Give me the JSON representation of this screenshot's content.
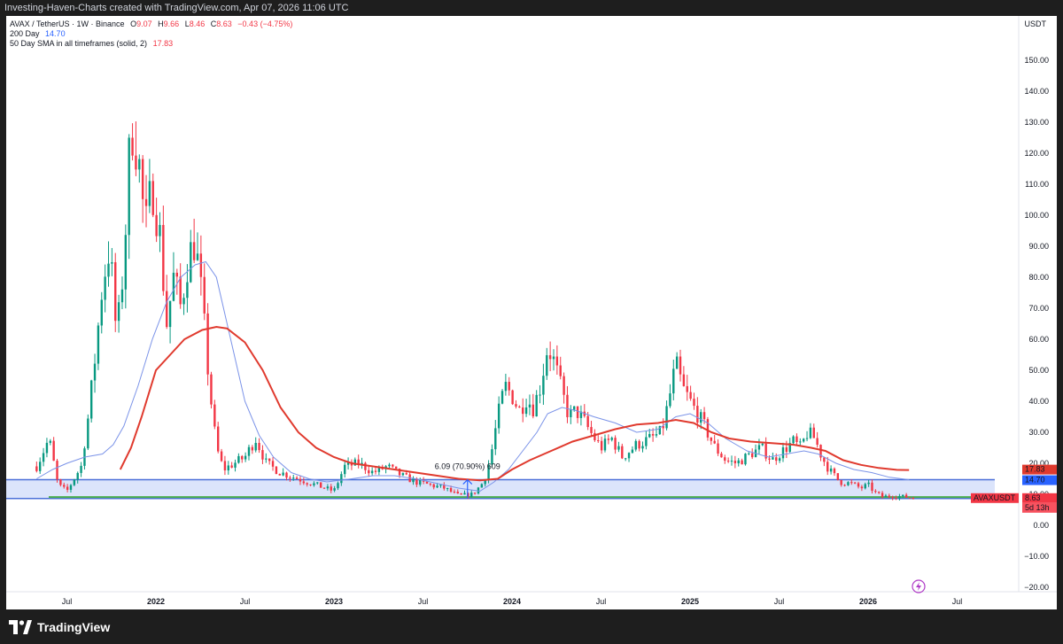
{
  "header": {
    "text": "Investing-Haven-Charts created with TradingView.com, Apr 07, 2026 11:06 UTC"
  },
  "legend": {
    "symbol_line": "AVAX / TetherUS · 1W · Binance",
    "ohlc": [
      {
        "k": "O",
        "v": "9.07"
      },
      {
        "k": "H",
        "v": "9.66"
      },
      {
        "k": "L",
        "v": "8.46"
      },
      {
        "k": "C",
        "v": "8.63"
      }
    ],
    "change": "−0.43 (−4.75%)",
    "sma200_label": "200 Day",
    "sma200_value": "14.70",
    "sma50_label": "50 Day SMA in all timeframes (solid, 2)",
    "sma50_value": "17.83"
  },
  "currency": "USDT",
  "footer": {
    "brand": "TradingView"
  },
  "colors": {
    "up": "#089981",
    "down": "#f23645",
    "sma50": "#e03a2e",
    "sma200": "#7b93e8",
    "zone_fill": "#dbe4fb",
    "zone_line": "#4a6fd8",
    "support_line": "#4caf50"
  },
  "chart_data": {
    "type": "candlestick",
    "symbol": "AVAXUSDT",
    "ylim": [
      -20,
      160
    ],
    "y_ticks": [
      "−20.00",
      "−10.00",
      "0.00",
      "10.00",
      "20.00",
      "30.00",
      "40.00",
      "50.00",
      "60.00",
      "70.00",
      "80.00",
      "90.00",
      "100.00",
      "110.00",
      "120.00",
      "130.00",
      "140.00",
      "150.00"
    ],
    "x_range": [
      2021.32,
      2026.98
    ],
    "x_ticks": [
      {
        "label": "Jul",
        "x": 2021.5
      },
      {
        "label": "2022",
        "x": 2022.0
      },
      {
        "label": "Jul",
        "x": 2022.5
      },
      {
        "label": "2023",
        "x": 2023.0
      },
      {
        "label": "Jul",
        "x": 2023.5
      },
      {
        "label": "2024",
        "x": 2024.0
      },
      {
        "label": "Jul",
        "x": 2024.5
      },
      {
        "label": "2025",
        "x": 2025.0
      },
      {
        "label": "Jul",
        "x": 2025.5
      },
      {
        "label": "2026",
        "x": 2026.0
      },
      {
        "label": "Jul",
        "x": 2026.5
      }
    ],
    "price_anchors": [
      [
        2021.33,
        19
      ],
      [
        2021.4,
        28
      ],
      [
        2021.45,
        13
      ],
      [
        2021.5,
        11
      ],
      [
        2021.58,
        19
      ],
      [
        2021.62,
        35
      ],
      [
        2021.66,
        55
      ],
      [
        2021.7,
        78
      ],
      [
        2021.74,
        90
      ],
      [
        2021.78,
        60
      ],
      [
        2021.82,
        85
      ],
      [
        2021.86,
        130
      ],
      [
        2021.9,
        120
      ],
      [
        2021.94,
        95
      ],
      [
        2021.98,
        110
      ],
      [
        2022.02,
        95
      ],
      [
        2022.06,
        65
      ],
      [
        2022.1,
        80
      ],
      [
        2022.14,
        70
      ],
      [
        2022.18,
        86
      ],
      [
        2022.22,
        92
      ],
      [
        2022.26,
        72
      ],
      [
        2022.3,
        45
      ],
      [
        2022.34,
        25
      ],
      [
        2022.38,
        18
      ],
      [
        2022.44,
        20
      ],
      [
        2022.5,
        22
      ],
      [
        2022.56,
        28
      ],
      [
        2022.62,
        20
      ],
      [
        2022.7,
        17
      ],
      [
        2022.8,
        15
      ],
      [
        2022.9,
        13
      ],
      [
        2023.0,
        11
      ],
      [
        2023.06,
        19
      ],
      [
        2023.14,
        20
      ],
      [
        2023.22,
        17
      ],
      [
        2023.3,
        19
      ],
      [
        2023.38,
        16
      ],
      [
        2023.46,
        14
      ],
      [
        2023.54,
        13
      ],
      [
        2023.62,
        12
      ],
      [
        2023.7,
        9.5
      ],
      [
        2023.78,
        10
      ],
      [
        2023.84,
        14
      ],
      [
        2023.88,
        22
      ],
      [
        2023.92,
        35
      ],
      [
        2023.96,
        45
      ],
      [
        2024.0,
        42
      ],
      [
        2024.04,
        37
      ],
      [
        2024.08,
        41
      ],
      [
        2024.12,
        38
      ],
      [
        2024.16,
        45
      ],
      [
        2024.2,
        58
      ],
      [
        2024.24,
        52
      ],
      [
        2024.28,
        43
      ],
      [
        2024.32,
        35
      ],
      [
        2024.36,
        37
      ],
      [
        2024.4,
        34
      ],
      [
        2024.44,
        30
      ],
      [
        2024.5,
        25
      ],
      [
        2024.56,
        28
      ],
      [
        2024.62,
        22
      ],
      [
        2024.7,
        26
      ],
      [
        2024.78,
        28
      ],
      [
        2024.84,
        30
      ],
      [
        2024.88,
        40
      ],
      [
        2024.92,
        52
      ],
      [
        2024.96,
        44
      ],
      [
        2025.0,
        40
      ],
      [
        2025.04,
        36
      ],
      [
        2025.08,
        32
      ],
      [
        2025.14,
        25
      ],
      [
        2025.2,
        21
      ],
      [
        2025.26,
        20
      ],
      [
        2025.34,
        23
      ],
      [
        2025.4,
        25
      ],
      [
        2025.46,
        21
      ],
      [
        2025.52,
        24
      ],
      [
        2025.58,
        27
      ],
      [
        2025.62,
        25
      ],
      [
        2025.66,
        30
      ],
      [
        2025.7,
        28
      ],
      [
        2025.74,
        22
      ],
      [
        2025.78,
        18
      ],
      [
        2025.84,
        14
      ],
      [
        2025.9,
        13.5
      ],
      [
        2025.96,
        12
      ],
      [
        2026.0,
        13
      ],
      [
        2026.04,
        10.5
      ],
      [
        2026.08,
        9.2
      ],
      [
        2026.14,
        9.5
      ],
      [
        2026.22,
        9.1
      ],
      [
        2026.27,
        8.63
      ]
    ],
    "series": [
      {
        "name": "50 Day SMA in all timeframes (solid, 2)",
        "points": [
          [
            2021.8,
            18
          ],
          [
            2021.86,
            25
          ],
          [
            2021.92,
            35
          ],
          [
            2022.0,
            50
          ],
          [
            2022.08,
            55
          ],
          [
            2022.16,
            60
          ],
          [
            2022.26,
            63
          ],
          [
            2022.34,
            64
          ],
          [
            2022.4,
            63.5
          ],
          [
            2022.5,
            59
          ],
          [
            2022.6,
            50
          ],
          [
            2022.7,
            38
          ],
          [
            2022.8,
            30
          ],
          [
            2022.9,
            25
          ],
          [
            2023.0,
            22
          ],
          [
            2023.1,
            20
          ],
          [
            2023.22,
            19
          ],
          [
            2023.34,
            18
          ],
          [
            2023.46,
            17
          ],
          [
            2023.58,
            16
          ],
          [
            2023.7,
            15
          ],
          [
            2023.82,
            14.5
          ],
          [
            2023.92,
            15
          ],
          [
            2024.0,
            18
          ],
          [
            2024.1,
            21
          ],
          [
            2024.22,
            24
          ],
          [
            2024.34,
            27
          ],
          [
            2024.46,
            29
          ],
          [
            2024.58,
            31
          ],
          [
            2024.7,
            32.5
          ],
          [
            2024.82,
            33
          ],
          [
            2024.92,
            34
          ],
          [
            2025.02,
            33
          ],
          [
            2025.12,
            30
          ],
          [
            2025.22,
            28
          ],
          [
            2025.34,
            27
          ],
          [
            2025.46,
            26.5
          ],
          [
            2025.58,
            26
          ],
          [
            2025.68,
            25
          ],
          [
            2025.76,
            24
          ],
          [
            2025.86,
            21
          ],
          [
            2025.96,
            19.5
          ],
          [
            2026.06,
            18.5
          ],
          [
            2026.16,
            17.9
          ],
          [
            2026.23,
            17.83
          ]
        ]
      },
      {
        "name": "200 Day",
        "points": [
          [
            2021.33,
            15
          ],
          [
            2021.42,
            18
          ],
          [
            2021.5,
            20
          ],
          [
            2021.6,
            22
          ],
          [
            2021.7,
            23
          ],
          [
            2021.76,
            26
          ],
          [
            2021.82,
            32
          ],
          [
            2021.9,
            45
          ],
          [
            2021.98,
            60
          ],
          [
            2022.06,
            72
          ],
          [
            2022.14,
            80
          ],
          [
            2022.22,
            84
          ],
          [
            2022.28,
            85
          ],
          [
            2022.34,
            80
          ],
          [
            2022.42,
            60
          ],
          [
            2022.5,
            40
          ],
          [
            2022.58,
            29
          ],
          [
            2022.66,
            22
          ],
          [
            2022.76,
            17
          ],
          [
            2022.86,
            15
          ],
          [
            2022.96,
            14
          ],
          [
            2023.1,
            15
          ],
          [
            2023.22,
            16
          ],
          [
            2023.34,
            16
          ],
          [
            2023.46,
            15
          ],
          [
            2023.58,
            13.5
          ],
          [
            2023.7,
            12
          ],
          [
            2023.82,
            11
          ],
          [
            2023.9,
            14
          ],
          [
            2023.98,
            18
          ],
          [
            2024.06,
            24
          ],
          [
            2024.14,
            30
          ],
          [
            2024.2,
            36
          ],
          [
            2024.28,
            38
          ],
          [
            2024.36,
            37
          ],
          [
            2024.46,
            35
          ],
          [
            2024.58,
            33
          ],
          [
            2024.7,
            30
          ],
          [
            2024.82,
            31
          ],
          [
            2024.92,
            35
          ],
          [
            2025.0,
            36
          ],
          [
            2025.1,
            33
          ],
          [
            2025.2,
            28
          ],
          [
            2025.32,
            24
          ],
          [
            2025.44,
            22
          ],
          [
            2025.54,
            23
          ],
          [
            2025.64,
            24
          ],
          [
            2025.72,
            23
          ],
          [
            2025.82,
            20
          ],
          [
            2025.92,
            18
          ],
          [
            2026.02,
            17
          ],
          [
            2026.12,
            15.5
          ],
          [
            2026.23,
            14.7
          ]
        ]
      }
    ],
    "range_zone": {
      "top": 14.7,
      "bottom": 8.63
    },
    "support_line": 9.1,
    "annotation": {
      "text": "6.09 (70.90%) 609",
      "x": 2023.75
    },
    "price_labels": [
      {
        "text": "17.83",
        "value": 17.83
      },
      {
        "text": "14.70",
        "value": 14.7
      },
      {
        "text": "AVAXUSDT",
        "value": 8.63
      },
      {
        "text": "8.63",
        "value": 8.63
      },
      {
        "text": "5d 13h",
        "value": 8.63
      }
    ]
  }
}
